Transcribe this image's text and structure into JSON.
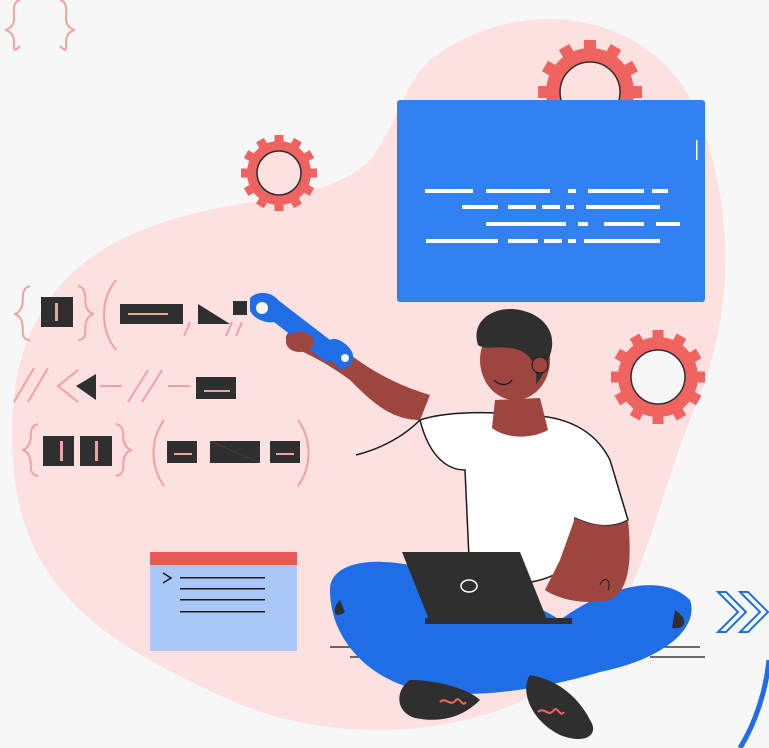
{
  "palette": {
    "background": "#f7f7f7",
    "blob": "#fde0e0",
    "gear": "#ef6461",
    "symbol": "#f2a0a0",
    "dark": "#2f2f2f",
    "screen_blue": "#3181f2",
    "skin": "#9e4540",
    "shirt": "#ffffff",
    "pants": "#1f6ee8",
    "window_body": "#a9c8f7",
    "window_bar": "#e9585a",
    "line": "#1a1a1a"
  },
  "icons": [
    "curly-braces-icon",
    "gear-icon",
    "code-window-icon",
    "terminal-window-icon",
    "wrench-icon",
    "laptop-icon",
    "double-chevron-icon"
  ]
}
